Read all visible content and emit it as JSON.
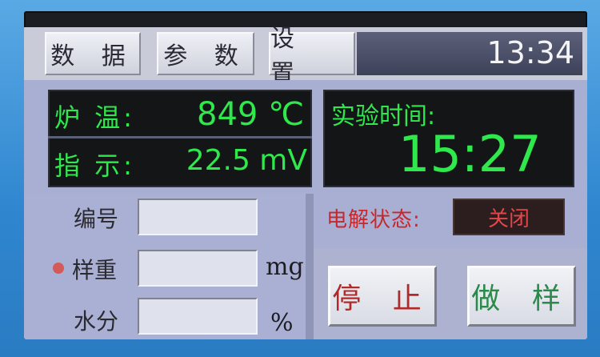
{
  "tabs": [
    {
      "label": "数 据"
    },
    {
      "label": "参 数"
    },
    {
      "label": "设 置"
    }
  ],
  "clock": "13:34",
  "furnace": {
    "temp_label": "炉 温:",
    "temp_value": "849 ℃",
    "indicator_label": "指 示:",
    "indicator_value": "22.5 mV"
  },
  "experiment": {
    "time_label": "实验时间:",
    "time_value": "15:27"
  },
  "form": {
    "id_label": "编号",
    "weight_label": "样重",
    "weight_unit": "mg",
    "moisture_label": "水分",
    "moisture_unit": "%"
  },
  "electrolysis": {
    "label": "电解状态:",
    "value": "关闭"
  },
  "actions": {
    "stop_label": "停 止",
    "sample_label": "做 样"
  },
  "colors": {
    "readout_green": "#2ee84c",
    "status_red": "#e2454a",
    "stop_text": "#b02a2a",
    "sample_text": "#2a8a4a"
  }
}
